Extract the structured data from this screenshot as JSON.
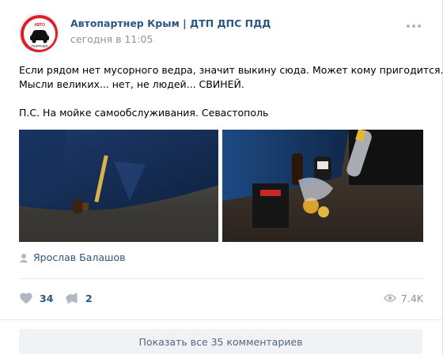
{
  "post": {
    "author": "Автопартнер Крым | ДТП ДПС ПДД",
    "date": "сегодня в 11:05",
    "avatar_text_top": "АВТО",
    "avatar_text_bottom": "ПАРТНЕР",
    "text_lines": [
      "Если рядом нет мусорного ведра, значит выкину сюда. Может кому пригодится.",
      "Мысли великих... нет, не людей... СВИНЕЙ.",
      "П.С. На мойке самообслуживания. Севастополь"
    ],
    "signer": "Ярослав Балашов"
  },
  "actions": {
    "likes": "34",
    "shares": "2",
    "views": "7.4K"
  },
  "comments_button": "Показать все 35 комментариев",
  "colors": {
    "link": "#2a5885",
    "muted": "#939393",
    "brand_red": "#e11d2b"
  },
  "icons": [
    "more-icon",
    "user-icon",
    "heart-icon",
    "share-icon",
    "eye-icon"
  ]
}
